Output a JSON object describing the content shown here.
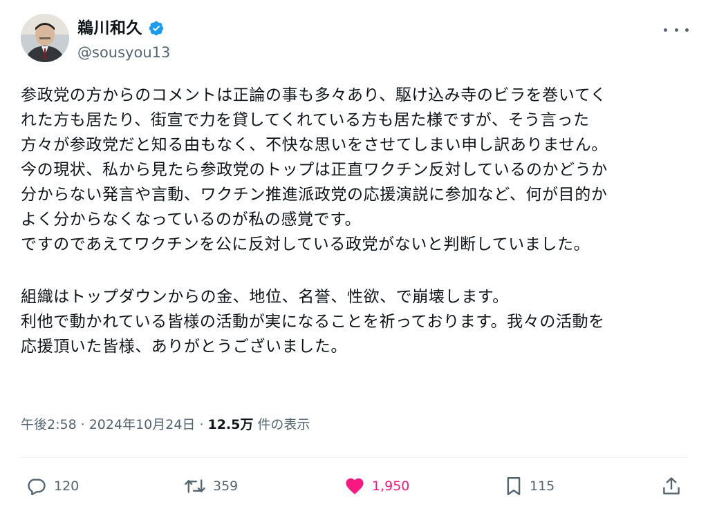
{
  "author": {
    "display_name": "鵜川和久",
    "handle": "@sousyou13",
    "verified": true,
    "avatar_icon": "profile-photo"
  },
  "tweet": {
    "paragraphs": [
      [
        "参政党の方からのコメントは正論の事も多々あり、駆け込み寺のビラを巻いてく",
        "れた方も居たり、街宣で力を貸してくれている方も居た様ですが、そう言った",
        "方々が参政党だと知る由もなく、不快な思いをさせてしまい申し訳ありません。",
        "今の現状、私から見たら参政党のトップは正直ワクチン反対しているのかどうか",
        "分からない発言や言動、ワクチン推進派政党の応援演説に参加など、何が目的か",
        "よく分からなくなっているのが私の感覚です。",
        "ですのであえてワクチンを公に反対している政党がないと判断していました。"
      ],
      [
        "組織はトップダウンからの金、地位、名誉、性欲、で崩壊します。",
        "利他で動かれている皆様の活動が実になることを祈っております。我々の活動を",
        "応援頂いた皆様、ありがとうございました。"
      ]
    ]
  },
  "meta": {
    "time": "午後2:58",
    "separator": "·",
    "date": "2024年10月24日",
    "views_count": "12.5万",
    "views_label": "件の表示"
  },
  "actions": {
    "reply_count": "120",
    "retweet_count": "359",
    "like_count": "1,950",
    "bookmark_count": "115"
  },
  "colors": {
    "like_active": "#f91880",
    "verified": "#1d9bf0",
    "secondary_text": "#536471",
    "primary_text": "#0f1419"
  }
}
